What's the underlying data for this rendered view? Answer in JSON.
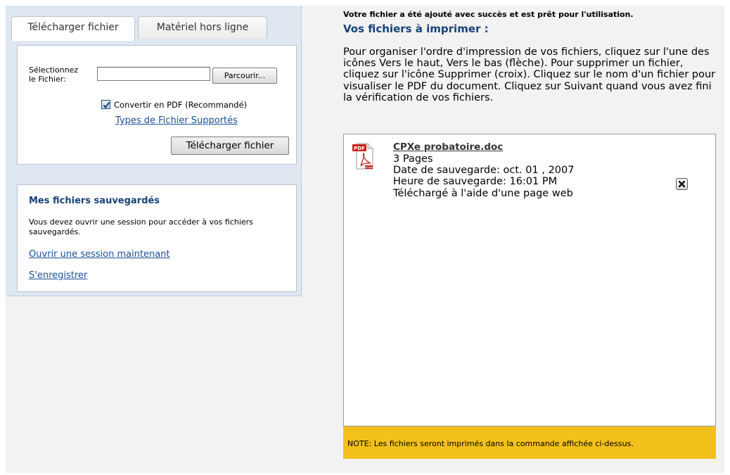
{
  "tabs": [
    {
      "label": "Télécharger fichier",
      "active": true
    },
    {
      "label": "Matériel hors ligne",
      "active": false
    }
  ],
  "upload": {
    "select_label": "Sélectionnez le Fichier:",
    "file_value": "",
    "browse_label": "Parcourir...",
    "convert_checked": true,
    "convert_label": "Convertir en PDF (Recommandé)",
    "supported_types_link": "Types de Fichier Supportés",
    "upload_button": "Télécharger fichier"
  },
  "saved": {
    "title": "Mes fichiers sauvegardés",
    "message": "Vous devez ouvrir une session pour accéder à vos fichiers sauvegardés.",
    "login_link": "Ouvrir une session maintenant",
    "register_link": "S'enregistrer"
  },
  "main": {
    "success_message": "Votre fichier a été ajouté avec succès et est prêt pour l'utilisation.",
    "files_title": "Vos fichiers à imprimer :",
    "instructions": "Pour organiser l'ordre d'impression de vos fichiers, cliquez sur l'une des icônes Vers le haut, Vers le bas (flèche). Pour supprimer un fichier, cliquez sur l'icône Supprimer (croix). Cliquez sur le nom d'un fichier pour visualiser le PDF du document. Cliquez sur Suivant quand vous avez fini la vérification de vos fichiers.",
    "files": [
      {
        "icon": "pdf-icon",
        "name": "CPXe probatoire.doc",
        "pages": "3 Pages",
        "save_date": "Date de sauvegarde: oct. 01 , 2007",
        "save_time": "Heure de sauvegarde: 16:01 PM",
        "source": "Téléchargé à l'aide d'une page web"
      }
    ],
    "note": "NOTE: Les fichiers seront imprimés dans la commande affichée ci-dessus."
  },
  "colors": {
    "sidebar_bg": "#dfe7f1",
    "title_blue": "#17427a",
    "link_blue": "#1a4f95",
    "note_yellow": "#f3c01b"
  }
}
